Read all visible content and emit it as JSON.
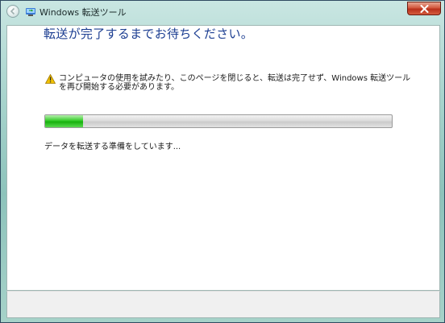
{
  "window": {
    "title": "Windows 転送ツール"
  },
  "main": {
    "heading": "転送が完了するまでお待ちください。",
    "warning_text": "コンピュータの使用を試みたり、このページを閉じると、転送は完了せず、Windows 転送ツールを再び開始する必要があります。",
    "progress_fraction": 0.11,
    "status_text": "データを転送する準備をしています..."
  },
  "icons": {
    "back": "back-arrow-icon",
    "app": "windows-easy-transfer-icon",
    "close": "close-icon",
    "warning": "warning-triangle-icon"
  },
  "colors": {
    "heading": "#1b3d91",
    "progress_fill": "#22b816",
    "close_button": "#c9432a",
    "warning": "#f2c200"
  }
}
